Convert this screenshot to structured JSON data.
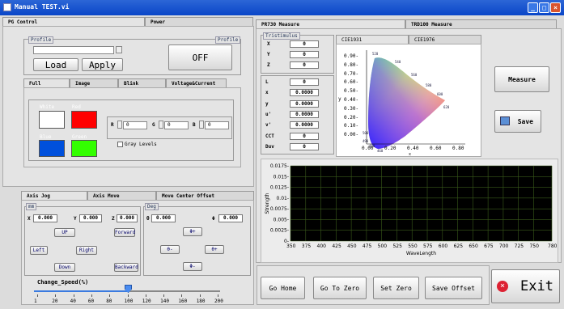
{
  "window": {
    "title": "Manual TEST.vi"
  },
  "pg_tabs": [
    "PG Control",
    "Power"
  ],
  "profile": {
    "group_label": "Profile",
    "right_label": "Profile",
    "input_value": "",
    "load": "Load",
    "apply": "Apply"
  },
  "power_button": "OFF",
  "pattern_tabs": [
    "Full",
    "Image",
    "Blink",
    "Voltage&Current"
  ],
  "colors": {
    "white": {
      "label": "White",
      "hex": "#ffffff"
    },
    "red": {
      "label": "Red",
      "hex": "#ff0000"
    },
    "blue": {
      "label": "Blue",
      "hex": "#0050dc"
    },
    "green": {
      "label": "Green",
      "hex": "#33ff00"
    }
  },
  "rgb": {
    "r_label": "R",
    "r": "0",
    "g_label": "G",
    "g": "0",
    "b_label": "B",
    "b": "0",
    "gray_levels": "Gray Levels"
  },
  "axis_tabs": [
    "Axis Jog",
    "Axis Move",
    "Move Center Offset"
  ],
  "mm": {
    "label": "mm",
    "x_label": "X",
    "x": "0.000",
    "y_label": "Y",
    "y": "0.000",
    "z_label": "Z",
    "z": "0.000",
    "up": "UP",
    "forward": "Forward",
    "left": "Left",
    "right": "Right",
    "down": "Down",
    "backward": "Backward"
  },
  "deg": {
    "label": "Deg",
    "theta_label": "θ",
    "theta": "0.000",
    "phi_label": "Φ",
    "phi": "0.000",
    "phi_plus": "Φ+",
    "theta_minus": "θ-",
    "theta_plus": "θ+",
    "phi_minus": "Φ-"
  },
  "speed": {
    "label": "Change_Speed(%)",
    "value": 100,
    "ticks": [
      "1",
      "20",
      "40",
      "60",
      "80",
      "100",
      "120",
      "140",
      "160",
      "180",
      "200"
    ]
  },
  "meas_tabs": [
    "PR730 Measure",
    "TRD100 Measure"
  ],
  "tristimulus": {
    "label": "Tristimulus",
    "rows": [
      {
        "k": "X",
        "v": "0"
      },
      {
        "k": "Y",
        "v": "0"
      },
      {
        "k": "Z",
        "v": "0"
      }
    ]
  },
  "params": [
    {
      "k": "L",
      "v": "0"
    },
    {
      "k": "x",
      "v": "0.0000"
    },
    {
      "k": "y",
      "v": "0.0000"
    },
    {
      "k": "u'",
      "v": "0.0000"
    },
    {
      "k": "v'",
      "v": "0.0000"
    },
    {
      "k": "CCT",
      "v": "0"
    },
    {
      "k": "Duv",
      "v": "0"
    }
  ],
  "cie_tabs": [
    "CIE1931",
    "CIE1976"
  ],
  "cie_axis": {
    "yticks": [
      "0.90-",
      "0.80-",
      "0.70-",
      "0.60-",
      "0.50-",
      "0.40-",
      "0.30-",
      "0.20-",
      "0.10-",
      "0.00-"
    ],
    "xticks": [
      "0.00",
      "0.20",
      "0.40",
      "0.60",
      "0.80"
    ],
    "xlabel": "x",
    "ylabel": "y"
  },
  "cie_wavelengths": [
    "520",
    "540",
    "560",
    "580",
    "600",
    "620",
    "500",
    "490",
    "480",
    "460"
  ],
  "measure_button": "Measure",
  "save_button": "Save",
  "chart_data": {
    "type": "line",
    "ylabel": "Strength",
    "xlabel": "WaveLength",
    "ylim": [
      0,
      0.0175
    ],
    "xlim": [
      350,
      780
    ],
    "yticks": [
      "0.0175-",
      "0.015-",
      "0.0125-",
      "0.01-",
      "0.0075-",
      "0.005-",
      "0.0025-",
      "0-"
    ],
    "xticks": [
      "350",
      "375",
      "400",
      "425",
      "450",
      "475",
      "500",
      "525",
      "550",
      "575",
      "600",
      "625",
      "650",
      "675",
      "700",
      "725",
      "750",
      "780"
    ],
    "series": [],
    "grid": true
  },
  "bottom_buttons": {
    "go_home": "Go Home",
    "go_zero": "Go To Zero",
    "set_zero": "Set Zero",
    "save_offset": "Save Offset",
    "exit": "Exit"
  }
}
